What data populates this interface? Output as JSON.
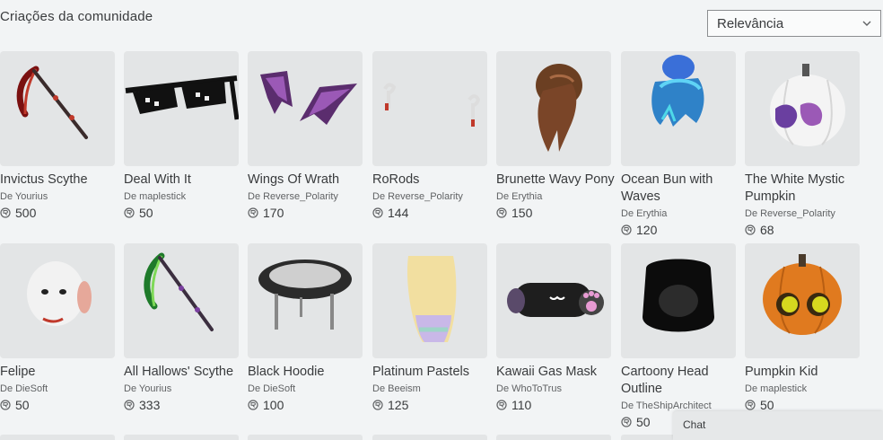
{
  "section": {
    "title": "Criações da comunidade"
  },
  "sort": {
    "selected": "Relevância",
    "icon": "chevron-down-icon"
  },
  "currency_icon": "robux-icon",
  "items": [
    {
      "name": "Invictus Scythe",
      "creator": "De Yourius",
      "price": "500",
      "icon": "scythe-red"
    },
    {
      "name": "Deal With It",
      "creator": "De maplestick",
      "price": "50",
      "icon": "pixel-sunglasses"
    },
    {
      "name": "Wings Of Wrath",
      "creator": "De Reverse_Polarity",
      "price": "170",
      "icon": "purple-wings"
    },
    {
      "name": "RoRods",
      "creator": "De Reverse_Polarity",
      "price": "144",
      "icon": "earbuds"
    },
    {
      "name": "Brunette Wavy Pony",
      "creator": "De Erythia",
      "price": "150",
      "icon": "brown-hair"
    },
    {
      "name": "Ocean Bun with Waves",
      "creator": "De Erythia",
      "price": "120",
      "icon": "blue-hair"
    },
    {
      "name": "The White Mystic Pumpkin",
      "creator": "De Reverse_Polarity",
      "price": "68",
      "icon": "white-pumpkin"
    },
    {
      "name": "Felipe",
      "creator": "De DieSoft",
      "price": "50",
      "icon": "white-head"
    },
    {
      "name": "All Hallows' Scythe",
      "creator": "De Yourius",
      "price": "333",
      "icon": "scythe-green"
    },
    {
      "name": "Black Hoodie",
      "creator": "De DieSoft",
      "price": "100",
      "icon": "black-hoodie"
    },
    {
      "name": "Platinum Pastels",
      "creator": "De Beeism",
      "price": "125",
      "icon": "pastel-hair"
    },
    {
      "name": "Kawaii Gas Mask",
      "creator": "De WhoToTrus",
      "price": "110",
      "icon": "gas-mask"
    },
    {
      "name": "Cartoony Head Outline",
      "creator": "De TheShipArchitect",
      "price": "50",
      "icon": "black-head"
    },
    {
      "name": "Pumpkin Kid",
      "creator": "De maplestick",
      "price": "50",
      "icon": "orange-pumpkin"
    }
  ],
  "chat": {
    "label": "Chat"
  },
  "colors": {
    "background": "#f2f4f5",
    "thumb": "#e3e5e6",
    "text": "#393b3d"
  }
}
